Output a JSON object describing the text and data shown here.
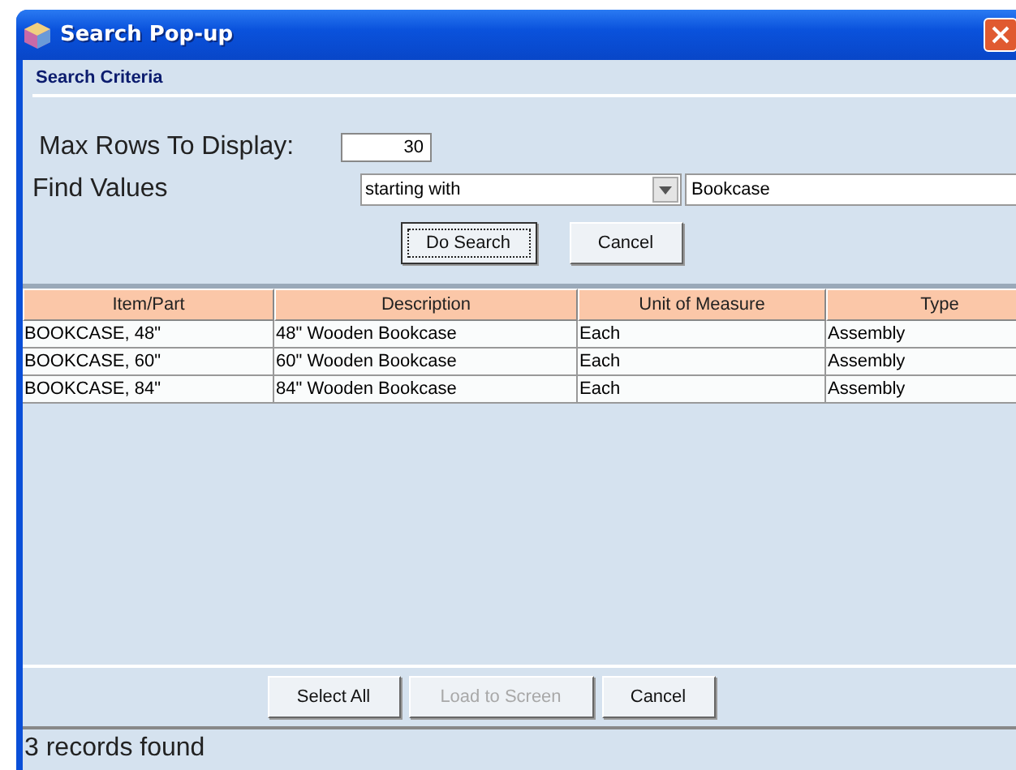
{
  "window": {
    "title": "Search Pop-up"
  },
  "section_title": "Search Criteria",
  "max_rows": {
    "label": "Max Rows To Display:",
    "value": "30"
  },
  "find_values": {
    "label": "Find Values",
    "operator": "starting with",
    "value": "Bookcase"
  },
  "criteria_buttons": [
    {
      "label": "Do Search",
      "disabled": false,
      "focused": true
    },
    {
      "label": "Cancel",
      "disabled": false,
      "focused": false
    }
  ],
  "table": {
    "columns": [
      "Item/Part",
      "Description",
      "Unit of Measure",
      "Type"
    ],
    "rows": [
      [
        "BOOKCASE, 48\"",
        "48\" Wooden Bookcase",
        "Each",
        "Assembly"
      ],
      [
        "BOOKCASE, 60\"",
        "60\" Wooden Bookcase",
        "Each",
        "Assembly"
      ],
      [
        "BOOKCASE, 84\"",
        "84\" Wooden Bookcase",
        "Each",
        "Assembly"
      ]
    ]
  },
  "footer_buttons": [
    {
      "label": "Select All",
      "disabled": false,
      "focused": false
    },
    {
      "label": "Load to Screen",
      "disabled": true,
      "focused": false
    },
    {
      "label": "Cancel",
      "disabled": false,
      "focused": false
    }
  ],
  "status_bar": "3 records found"
}
